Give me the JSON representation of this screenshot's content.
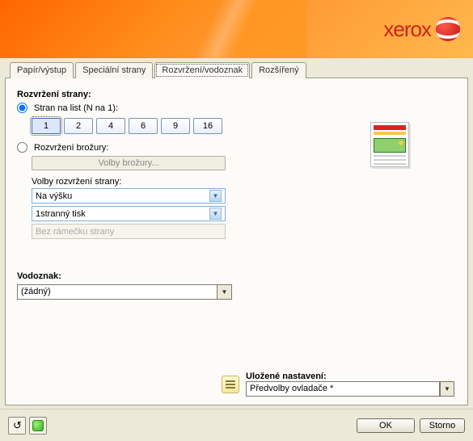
{
  "brand": {
    "name": "xerox"
  },
  "tabs": [
    {
      "label": "Papír/výstup"
    },
    {
      "label": "Speciální strany"
    },
    {
      "label": "Rozvržení/vodoznak"
    },
    {
      "label": "Rozšířený"
    }
  ],
  "layout": {
    "section_title": "Rozvržení strany:",
    "radio_pages": "Stran na list (N na 1):",
    "nup": [
      "1",
      "2",
      "4",
      "6",
      "9",
      "16"
    ],
    "radio_booklet": "Rozvržení brožury:",
    "booklet_button": "Volby brožury...",
    "options_label": "Volby rozvržení strany:",
    "orientation_value": "Na výšku",
    "sided_value": "1stranný tisk",
    "border_value": "Bez rámečku strany"
  },
  "watermark": {
    "section_title": "Vodoznak:",
    "value": "(žádný)"
  },
  "saved": {
    "label": "Uložené nastavení:",
    "value": "Předvolby ovladače *"
  },
  "footer": {
    "ok": "OK",
    "cancel": "Storno"
  }
}
